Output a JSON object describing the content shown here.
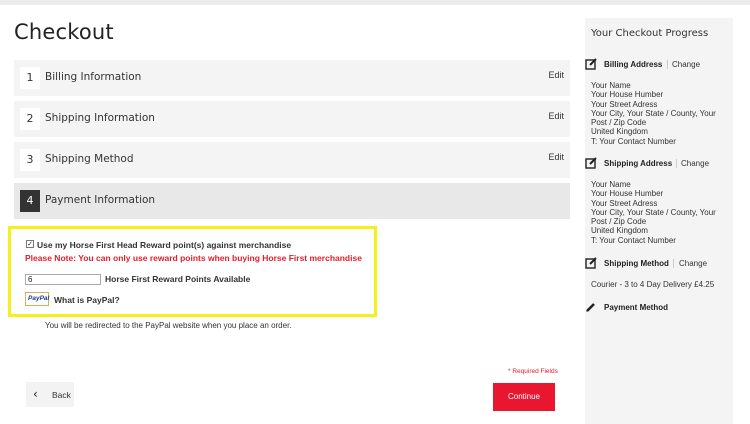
{
  "page": {
    "title": "Checkout"
  },
  "steps": [
    {
      "number": "1",
      "label": "Billing Information",
      "edit": "Edit"
    },
    {
      "number": "2",
      "label": "Shipping Information",
      "edit": "Edit"
    },
    {
      "number": "3",
      "label": "Shipping Method",
      "edit": "Edit"
    },
    {
      "number": "4",
      "label": "Payment Information"
    }
  ],
  "payment": {
    "reward_checkbox_checked": true,
    "reward_label": "Use my Horse First Head Reward point(s) against merchandise",
    "reward_note": "Please Note: You can only use reward points when buying Horse First merchandise",
    "points_value": "6",
    "points_label": "Horse First Reward Points Available",
    "paypal_logo_text": "PayPal",
    "paypal_what": "What is PayPal?",
    "redirect_text": "You will be redirected to the PayPal website when you place an order."
  },
  "footer": {
    "required": "* Required Fields",
    "back": "Back",
    "continue": "Continue"
  },
  "progress": {
    "title": "Your Checkout Progress",
    "billing": {
      "header": "Billing Address",
      "change": "Change",
      "lines": [
        "Your Name",
        "Your House Humber",
        "Your Street Adress",
        "Your City, Your State / County, Your",
        "Post / Zip Code",
        "United Kingdom",
        "T: Your Contact Number"
      ]
    },
    "shipping": {
      "header": "Shipping Address",
      "change": "Change",
      "lines": [
        "Your Name",
        "Your House Humber",
        "Your Street Adress",
        "Your City, Your State / County, Your",
        "Post / Zip Code",
        "United Kingdom",
        "T: Your Contact Number"
      ]
    },
    "method": {
      "header": "Shipping Method",
      "change": "Change",
      "value": "Courier - 3 to 4 Day Delivery £4.25"
    },
    "payment": {
      "header": "Payment Method"
    }
  },
  "colors": {
    "accent": "#e8172f",
    "highlight": "#f5f01a",
    "note": "#e0202b"
  },
  "icons": {
    "edit_section": "pencil-square-icon",
    "edit_active": "pencil-icon",
    "back": "chevron-left-icon"
  }
}
